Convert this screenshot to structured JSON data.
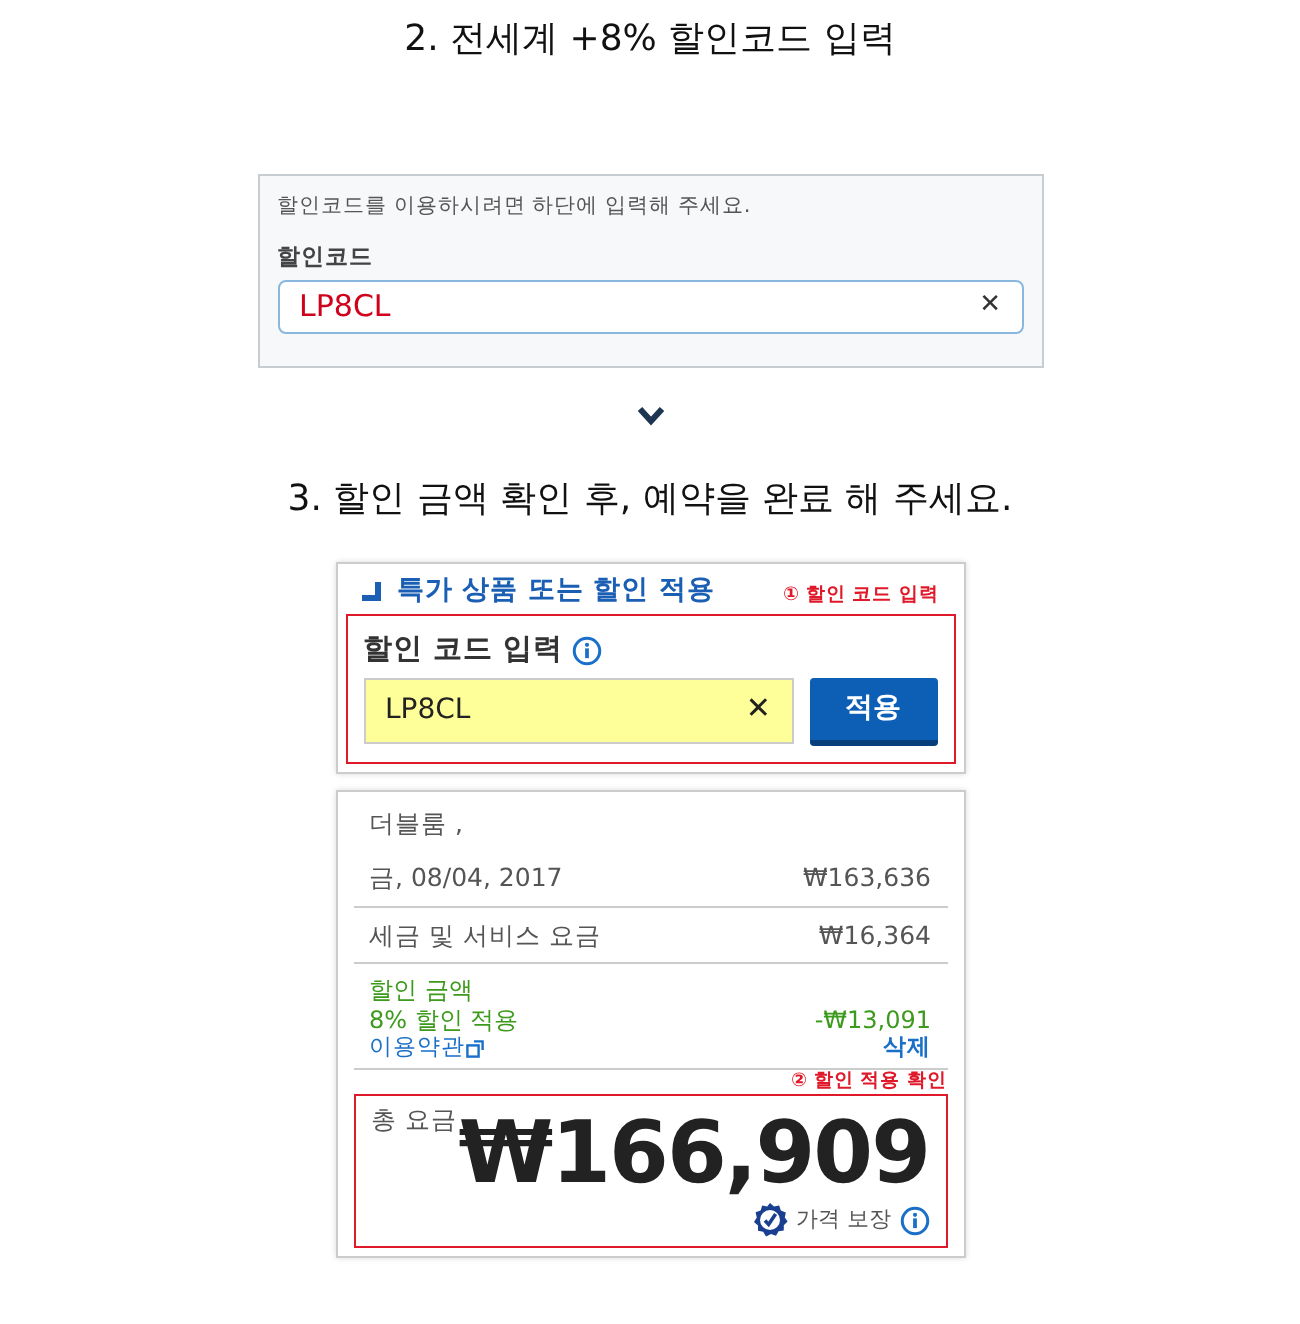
{
  "step2": {
    "heading": "2. 전세계 +8% 할인코드 입력",
    "hint": "할인코드를 이용하시려면 하단에 입력해 주세요.",
    "label": "할인코드",
    "code": "LP8CL",
    "clear": "✕"
  },
  "step3": {
    "heading": "3. 할인 금액 확인 후, 예약을 완료 해 주세요.",
    "section_title": "특가 상품 또는 할인 적용",
    "callout": "① 할인 코드 입력",
    "label": "할인 코드 입력",
    "code": "LP8CL",
    "clear": "✕",
    "apply": "적용"
  },
  "summary": {
    "room": "더블룸 ,",
    "lines": [
      {
        "label": "금, 08/04, 2017",
        "amount": "₩163,636"
      },
      {
        "label": "세금 및 서비스 요금",
        "amount": "₩16,364"
      }
    ],
    "discount": {
      "title": "할인 금액",
      "detail": "8% 할인 적용",
      "terms_link": "이용약관",
      "amount": "-₩13,091",
      "remove": "삭제"
    },
    "callout": "② 할인 적용 확인",
    "total_label": "총 요금",
    "total": "₩166,909",
    "guarantee": "가격 보장"
  }
}
